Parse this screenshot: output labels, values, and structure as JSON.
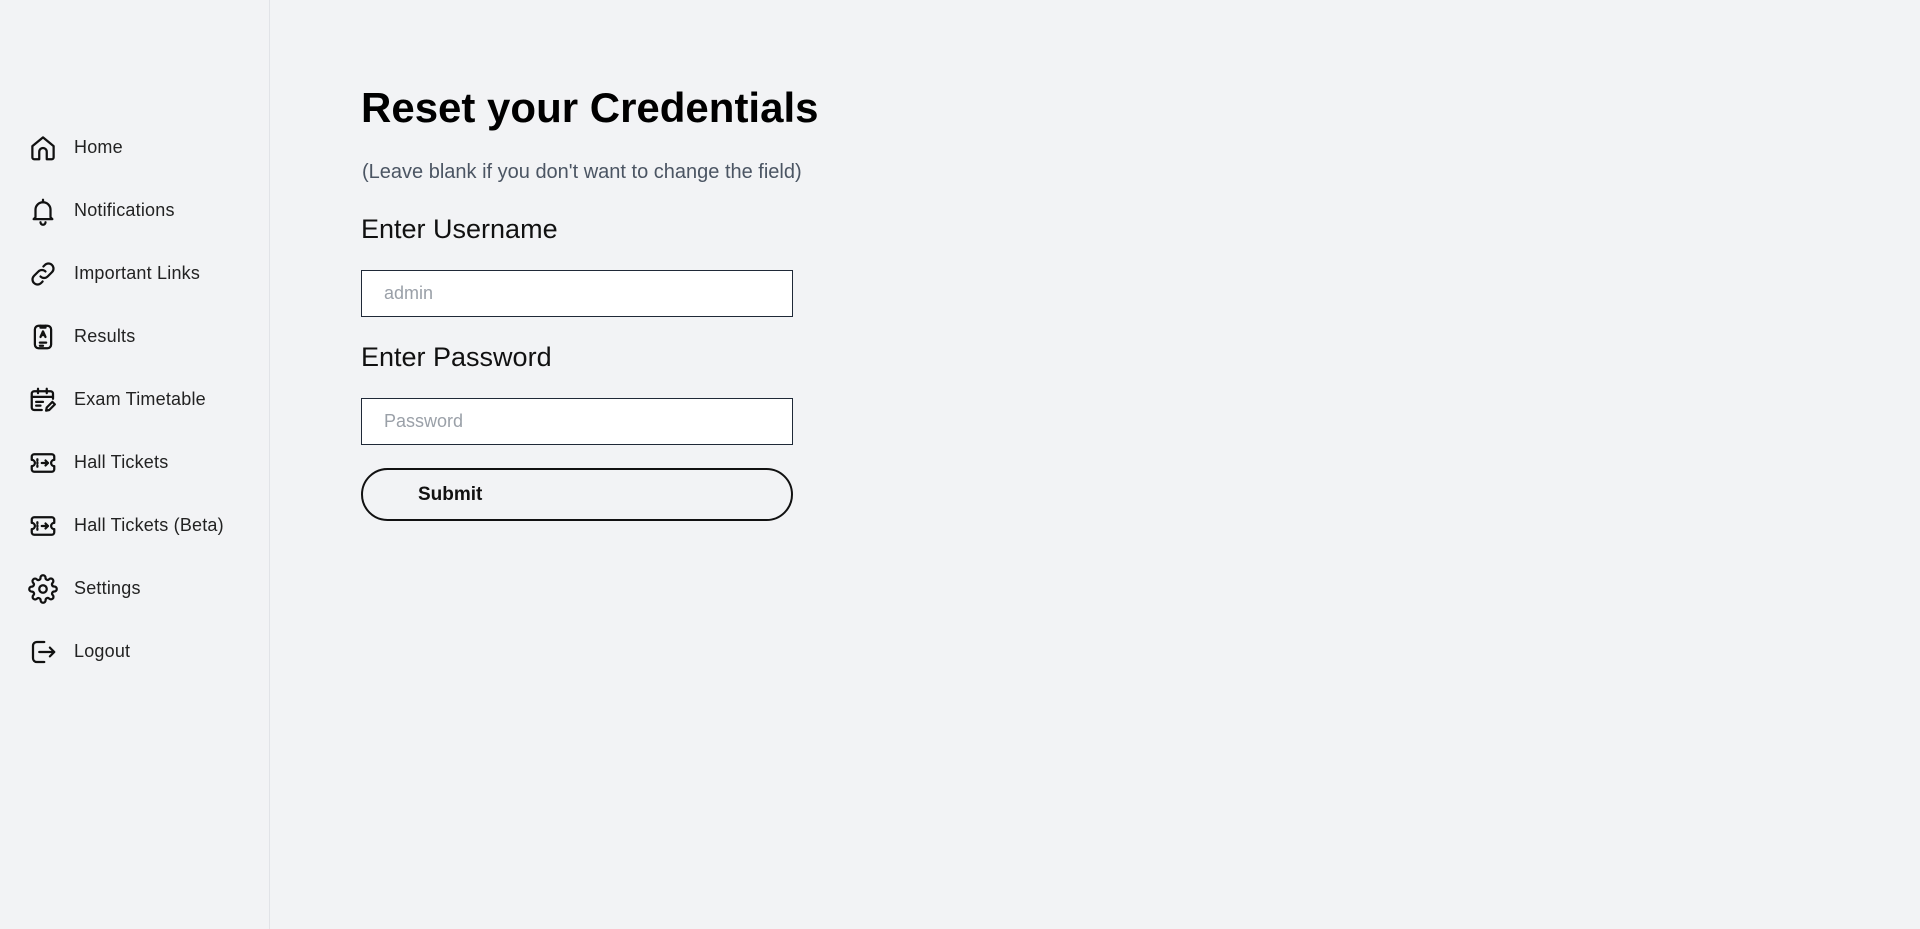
{
  "sidebar": {
    "items": [
      {
        "label": "Home",
        "icon": "home-icon"
      },
      {
        "label": "Notifications",
        "icon": "bell-icon"
      },
      {
        "label": "Important Links",
        "icon": "link-icon"
      },
      {
        "label": "Results",
        "icon": "result-document-icon"
      },
      {
        "label": "Exam Timetable",
        "icon": "calendar-edit-icon"
      },
      {
        "label": "Hall Tickets",
        "icon": "ticket-icon"
      },
      {
        "label": "Hall Tickets (Beta)",
        "icon": "ticket-icon"
      },
      {
        "label": "Settings",
        "icon": "gear-icon"
      },
      {
        "label": "Logout",
        "icon": "logout-icon"
      }
    ]
  },
  "main": {
    "title": "Reset your Credentials",
    "subtitle": "(Leave blank if you don't want to change the field)",
    "username_label": "Enter Username",
    "username_placeholder": "admin",
    "password_label": "Enter Password",
    "password_placeholder": "Password",
    "submit_label": "Submit"
  }
}
